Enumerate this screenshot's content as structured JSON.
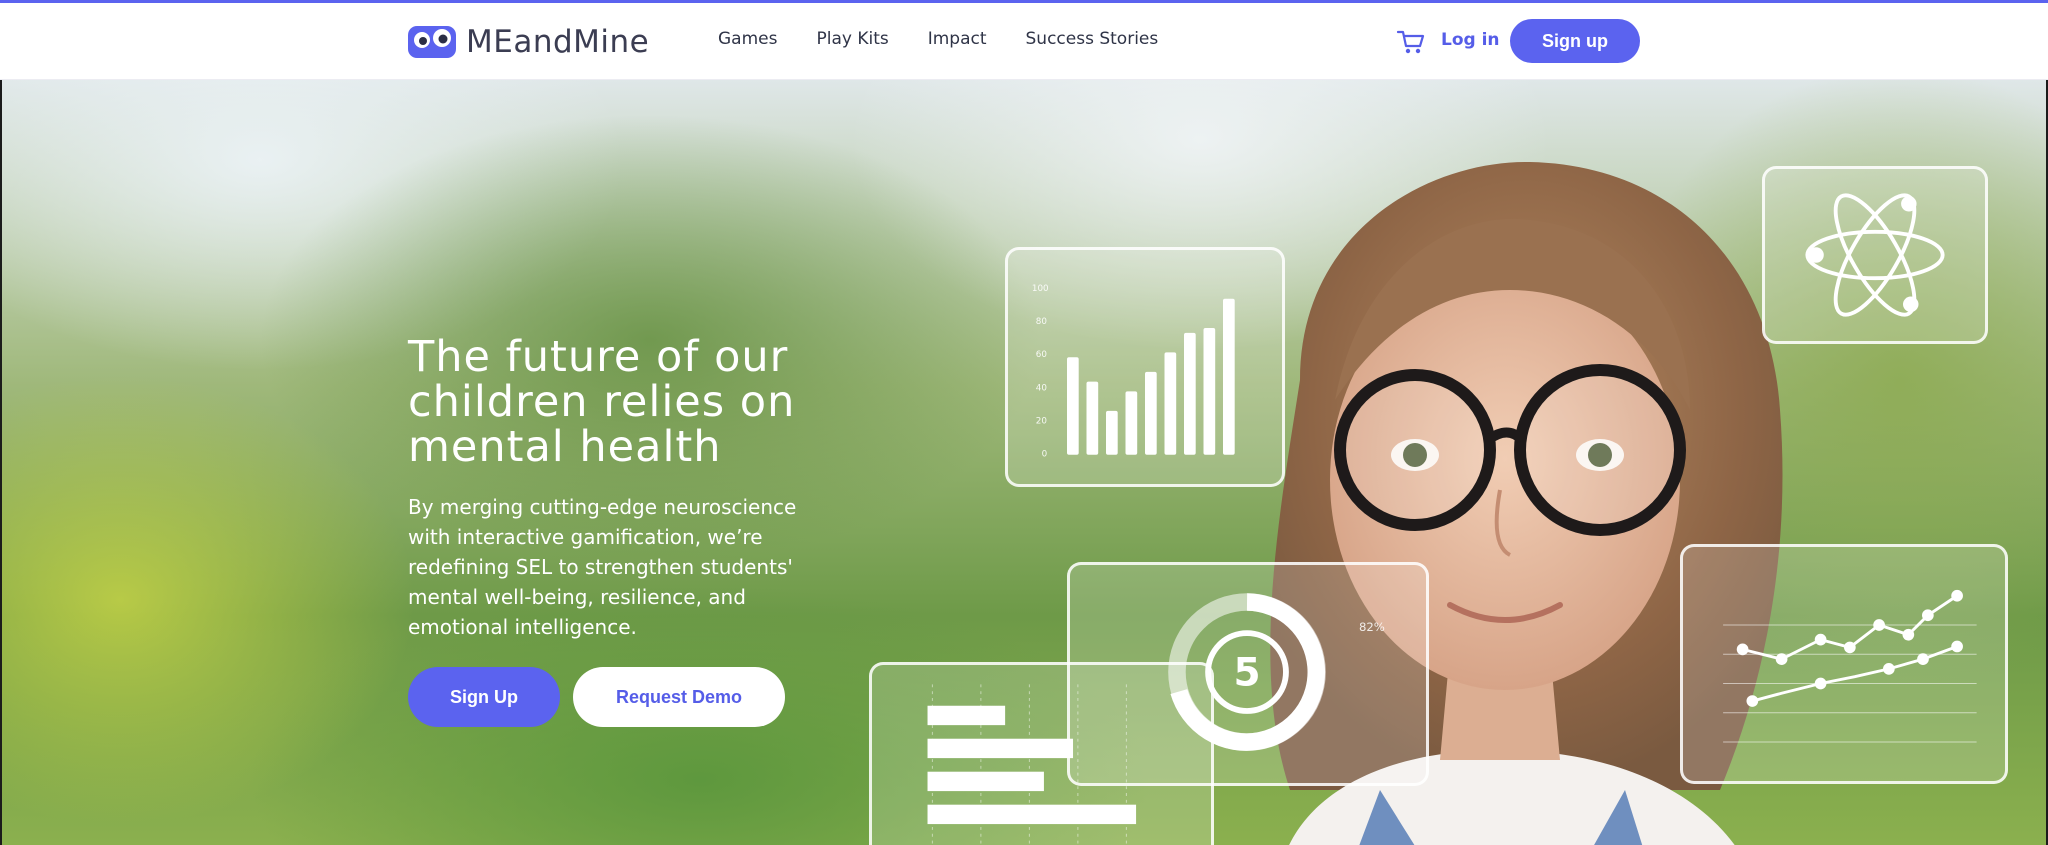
{
  "brand": {
    "name": "MEandMine",
    "accent_color": "#5b63ef"
  },
  "nav": {
    "links": [
      "Games",
      "Play Kits",
      "Impact",
      "Success Stories"
    ],
    "cart_icon": "cart-icon",
    "login_label": "Log in",
    "signup_label": "Sign up"
  },
  "hero": {
    "title": "The future of our children relies on mental health",
    "description": "By merging cutting-edge neuroscience with interactive gamification, we’re redefining SEL to strengthen students' mental well-being, resilience, and emotional intelligence.",
    "primary_button": "Sign Up",
    "secondary_button": "Request Demo",
    "overlay_bar_ticks": [
      "100",
      "80",
      "60",
      "40",
      "20",
      "0"
    ],
    "overlay_gauge_value": "5",
    "overlay_percent": "82%"
  }
}
